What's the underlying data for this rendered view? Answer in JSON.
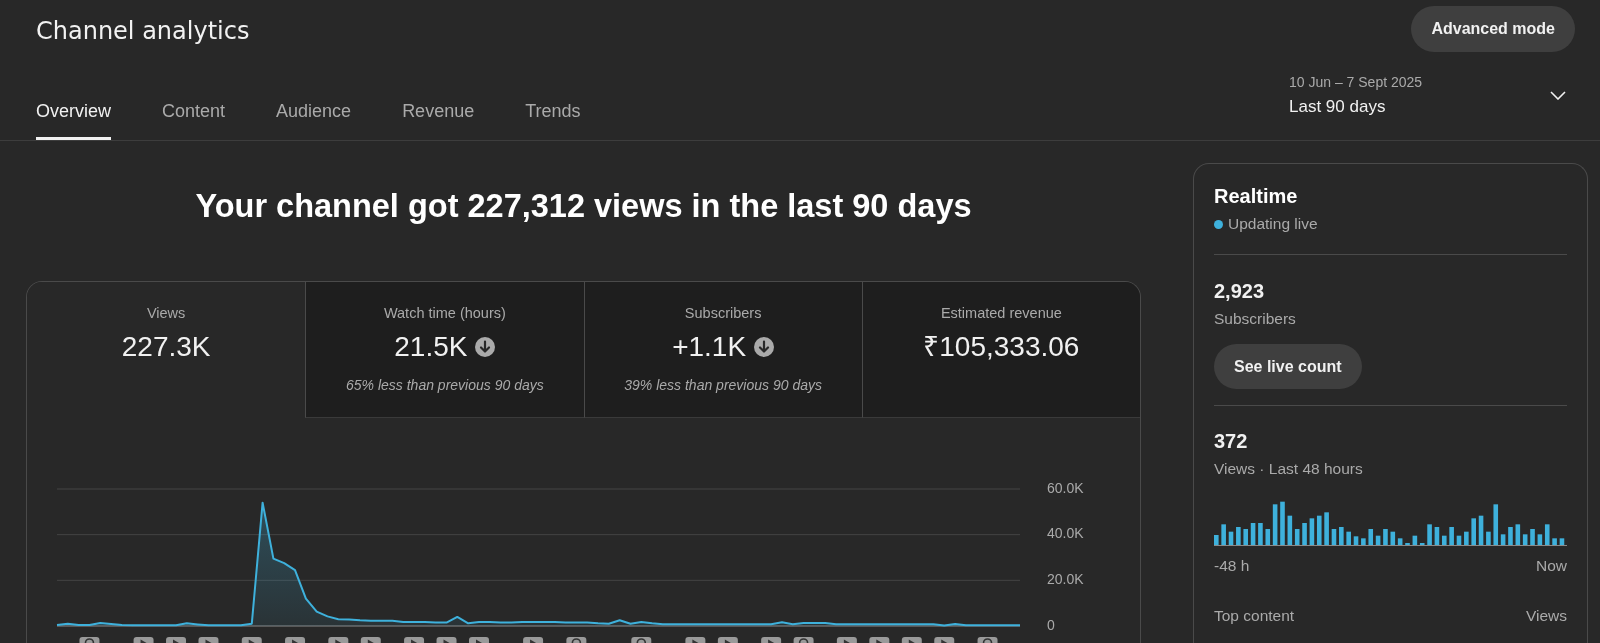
{
  "header": {
    "title": "Channel analytics",
    "action_button": "Advanced mode"
  },
  "tabs": [
    {
      "label": "Overview",
      "selected": true
    },
    {
      "label": "Content",
      "selected": false
    },
    {
      "label": "Audience",
      "selected": false
    },
    {
      "label": "Revenue",
      "selected": false
    },
    {
      "label": "Trends",
      "selected": false
    }
  ],
  "date_range": {
    "dates": "10 Jun – 7 Sept 2025",
    "preset": "Last 90 days"
  },
  "headline": "Your channel got 227,312 views in the last 90 days",
  "metrics": [
    {
      "label": "Views",
      "value": "227.3K",
      "selected": true
    },
    {
      "label": "Watch time (hours)",
      "value": "21.5K",
      "trend_down": true,
      "comparison": "65% less than previous 90 days",
      "selected": false
    },
    {
      "label": "Subscribers",
      "value": "+1.1K",
      "trend_down": true,
      "comparison": "39% less than previous 90 days",
      "selected": false
    },
    {
      "label": "Estimated revenue",
      "value": "₹105,333.06",
      "selected": false
    }
  ],
  "chart": {
    "chart_data": {
      "type": "area",
      "ylim": [
        0,
        60000
      ],
      "yticks": [
        {
          "value": 0,
          "label": "0"
        },
        {
          "value": 20000,
          "label": "20.0K"
        },
        {
          "value": 40000,
          "label": "40.0K"
        },
        {
          "value": 60000,
          "label": "60.0K"
        }
      ],
      "values": [
        500,
        1000,
        500,
        400,
        1300,
        900,
        500,
        300,
        300,
        300,
        300,
        300,
        1200,
        700,
        300,
        300,
        300,
        300,
        1000,
        54000,
        29500,
        27500,
        24500,
        12000,
        6300,
        4200,
        3000,
        2800,
        2500,
        2300,
        2300,
        2300,
        1800,
        1800,
        1800,
        1500,
        1500,
        4000,
        1200,
        1800,
        1800,
        1500,
        1500,
        1800,
        1800,
        1800,
        1700,
        1500,
        1500,
        1500,
        1200,
        1000,
        2500,
        1000,
        1800,
        1200,
        800,
        800,
        800,
        800,
        800,
        800,
        800,
        800,
        800,
        800,
        800,
        1600,
        800,
        1300,
        1300,
        1300,
        800,
        800,
        800,
        800,
        800,
        800,
        800,
        800,
        800,
        800,
        200,
        900,
        300,
        300,
        300,
        300,
        300,
        300
      ]
    },
    "markers": [
      {
        "kind": "round"
      },
      {
        "kind": "play"
      },
      {
        "kind": "play"
      },
      {
        "kind": "play"
      },
      {
        "kind": "play"
      },
      {
        "kind": "play"
      },
      {
        "kind": "play"
      },
      {
        "kind": "play"
      },
      {
        "kind": "play"
      },
      {
        "kind": "play"
      },
      {
        "kind": "play"
      },
      {
        "kind": "play"
      },
      {
        "kind": "round"
      },
      {
        "kind": "round"
      },
      {
        "kind": "play"
      },
      {
        "kind": "play"
      },
      {
        "kind": "play"
      },
      {
        "kind": "round"
      },
      {
        "kind": "play"
      },
      {
        "kind": "play"
      },
      {
        "kind": "play"
      },
      {
        "kind": "play"
      },
      {
        "kind": "round"
      }
    ]
  },
  "realtime": {
    "title": "Realtime",
    "status": "Updating live",
    "subscribers": {
      "value": "2,923",
      "label": "Subscribers",
      "button": "See live count"
    },
    "views": {
      "value": "372",
      "label": "Views · Last 48 hours",
      "axis_start": "-48 h",
      "axis_end": "Now"
    },
    "top_content": {
      "label": "Top content",
      "column": "Views"
    }
  }
}
